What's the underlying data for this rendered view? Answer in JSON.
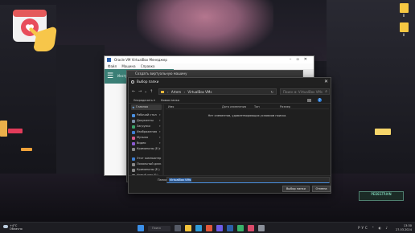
{
  "colors": {
    "accent": "#2f7fd8",
    "vbox_green": "#3b7f76",
    "folder_yellow": "#e9b73a"
  },
  "desktop": {
    "icons": [
      {
        "label": "Ⅱ",
        "icon": "folder-icon"
      },
      {
        "label": "Ⅱ",
        "icon": "folder-icon"
      }
    ],
    "street_sign": "PEDESTRIAN"
  },
  "vbox_window": {
    "title": "Oracle VM VirtualBox Менеджер",
    "menu": [
      "Файл",
      "Машина",
      "Справка"
    ],
    "tools_label": "Инструменты"
  },
  "mid_window": {
    "title": "Создать виртуальную машину"
  },
  "dialog": {
    "title": "Выбор папки",
    "address": {
      "crumbs": [
        "Artem",
        "VirtualBox VMs"
      ]
    },
    "search_placeholder": "Поиск в: VirtualBox VMs",
    "commands": {
      "organize": "Упорядочить ▾",
      "new_folder": "Новая папка"
    },
    "nav": {
      "quick_access": "Главная",
      "items": [
        {
          "label": "Рабочий стол",
          "color": "#4a90e2",
          "pinned": true
        },
        {
          "label": "Документы",
          "color": "#7b8fa6",
          "pinned": true
        },
        {
          "label": "Загрузки",
          "color": "#3ba36a",
          "pinned": true
        },
        {
          "label": "Изображения",
          "color": "#3f7fd1",
          "pinned": true
        },
        {
          "label": "Музыка",
          "color": "#d45b8a",
          "pinned": true
        },
        {
          "label": "Видео",
          "color": "#8b5ad0",
          "pinned": true
        },
        {
          "label": "Криминалы (E:)",
          "color": "#888888",
          "pinned": true
        }
      ],
      "section_items": [
        {
          "label": "Этот компьютер",
          "color": "#3f7fd1"
        },
        {
          "label": "Локальный диск",
          "color": "#888888"
        },
        {
          "label": "Криминалы (E:)",
          "color": "#888888"
        },
        {
          "label": "Новый том (F:)",
          "color": "#888888"
        }
      ]
    },
    "columns": [
      "Имя",
      "Дата изменения",
      "Тип",
      "Размер"
    ],
    "empty_message": "Нет элементов, удовлетворяющих условиям поиска.",
    "folder_label": "Папка:",
    "folder_value": "VirtualBox VMs",
    "select_button": "Выбор папки",
    "cancel_button": "Отмена"
  },
  "taskbar": {
    "weather_temp": "+4°C",
    "weather_desc": "Облачно",
    "search_placeholder": "Поиск",
    "time": "13:30",
    "date": "27.03.2024",
    "language": "РУС"
  }
}
